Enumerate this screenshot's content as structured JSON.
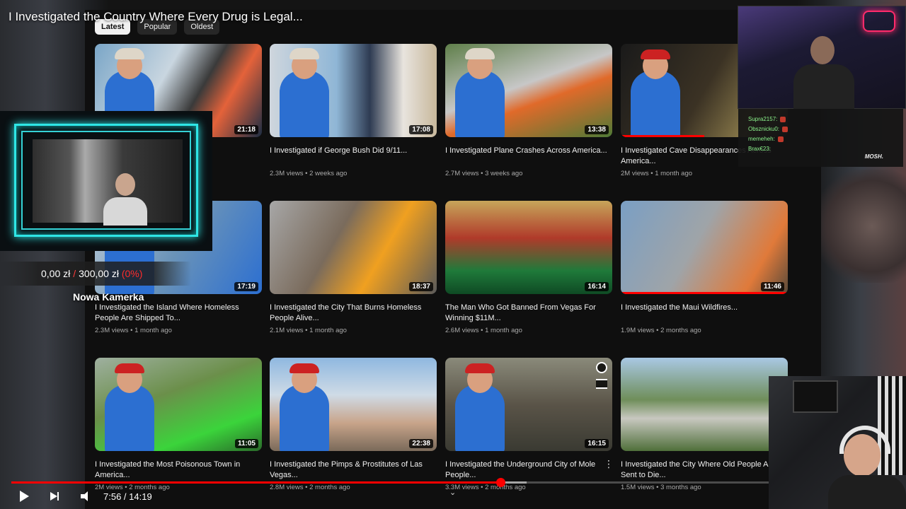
{
  "overlay_title": "I Investigated the Country Where Every Drug is Legal...",
  "chips": [
    {
      "label": "Latest",
      "active": true
    },
    {
      "label": "Popular",
      "active": false
    },
    {
      "label": "Oldest",
      "active": false
    }
  ],
  "videos": [
    {
      "title": "",
      "meta": "",
      "duration": "21:18",
      "thumb_bg": "linear-gradient(120deg,#7aa6c7 0%,#c9d6e0 40%,#3a3a3a 60%,#e4623a 75%,#1c2d44 100%)",
      "person": "hat",
      "watched": 0.0
    },
    {
      "title": "I Investigated if George Bush Did 9/11...",
      "meta": "2.3M views • 2 weeks ago",
      "duration": "17:08",
      "thumb_bg": "linear-gradient(90deg,#cfd6dd 0%,#8fb6d6 40%,#2e3b52 60%,#e8e4de 80%,#c8b89c 100%)",
      "person": "hat",
      "watched": 0.0
    },
    {
      "title": "I Investigated Plane Crashes Across America...",
      "meta": "2.7M views • 3 weeks ago",
      "duration": "13:38",
      "thumb_bg": "linear-gradient(160deg,#5f7f4a 0%,#c7c7c7 45%,#e06a2a 60%,#4f7a36 100%)",
      "person": "hat",
      "watched": 0.0
    },
    {
      "title": "I Investigated Cave Disappearances Across America...",
      "meta": "2M views • 1 month ago",
      "duration": "",
      "thumb_bg": "linear-gradient(120deg,#1a1a1a 0%,#3b3224 50%,#8a7a4a 80%,#222 100%)",
      "person": "cap",
      "watched": 0.5
    },
    {
      "title": "I Investigated the Island Where Homeless People Are Shipped To...",
      "meta": "2.3M views • 1 month ago",
      "duration": "17:19",
      "thumb_bg": "linear-gradient(120deg,#b8c8d6 0%,#6a93b8 50%,#2c6fd1 100%)",
      "person": "cap",
      "watched": 0.0
    },
    {
      "title": "I Investigated the City That Burns Homeless People Alive...",
      "meta": "2.1M views • 1 month ago",
      "duration": "18:37",
      "thumb_bg": "linear-gradient(120deg,#a7a7a7 0%,#7a6b5c 40%,#f0a020 65%,#5a5a5a 100%)",
      "person": "none",
      "watched": 0.0
    },
    {
      "title": "The Man Who Got Banned From Vegas For Winning $11M...",
      "meta": "2.6M views • 1 month ago",
      "duration": "16:14",
      "thumb_bg": "linear-gradient(180deg,#c7a55a 0%,#b03a2a 40%,#1f7a3a 75%,#0f4a24 100%)",
      "person": "none",
      "watched": 0.0
    },
    {
      "title": "I Investigated the Maui Wildfires...",
      "meta": "1.9M views • 2 months ago",
      "duration": "11:46",
      "thumb_bg": "linear-gradient(120deg,#7a9fc4 0%,#9fa4a8 45%,#e07a3a 80%,#5a4a3a 100%)",
      "person": "none",
      "watched": 1.0
    },
    {
      "title": "I Investigated the Most Poisonous Town in America...",
      "meta": "2M views • 2 months ago",
      "duration": "11:05",
      "thumb_bg": "linear-gradient(160deg,#9fb0a0 0%,#6b8f4a 40%,#3bd43b 75%,#2a6a2a 100%)",
      "person": "cap",
      "watched": 0.0
    },
    {
      "title": "I Investigated the Pimps & Prostitutes of Las Vegas...",
      "meta": "2.8M views • 2 months ago",
      "duration": "22:38",
      "thumb_bg": "linear-gradient(180deg,#8fb8e0 0%,#cfdbe6 40%,#c8a48a 70%,#7a6a5a 100%)",
      "person": "cap",
      "watched": 0.0
    },
    {
      "title": "I Investigated the Underground City of Mole People...",
      "meta": "3.3M views • 2 months ago",
      "duration": "16:15",
      "thumb_bg": "linear-gradient(180deg,#8a8a7a 0%,#5a5448 50%,#3a3a32 100%)",
      "person": "cap",
      "watched": 0.0
    },
    {
      "title": "I Investigated the City Where Old People Are Sent to Die...",
      "meta": "1.5M views • 3 months ago",
      "duration": "",
      "thumb_bg": "linear-gradient(180deg,#a9c8e4 0%,#6f8e5a 45%,#c8c8c0 65%,#4f6f3a 100%)",
      "person": "none",
      "watched": 0.0
    }
  ],
  "donation": {
    "current": "0,00 zł",
    "sep": "/",
    "goal": "300,00 zł",
    "pct": "(0%)"
  },
  "cam_label": "Nowa Kamerka",
  "chat": {
    "lines": [
      "Supra2157:",
      "Obsznicku0:",
      "memeheh:",
      "Brax€23:"
    ],
    "logo": "MOSH."
  },
  "player": {
    "time": "7:56 / 14:19",
    "progress": 0.646,
    "buffered": 0.68
  },
  "colors": {
    "accent": "#ff0000",
    "neon_frame": "#2ee6e6",
    "chat_name": "#8cf58c"
  }
}
